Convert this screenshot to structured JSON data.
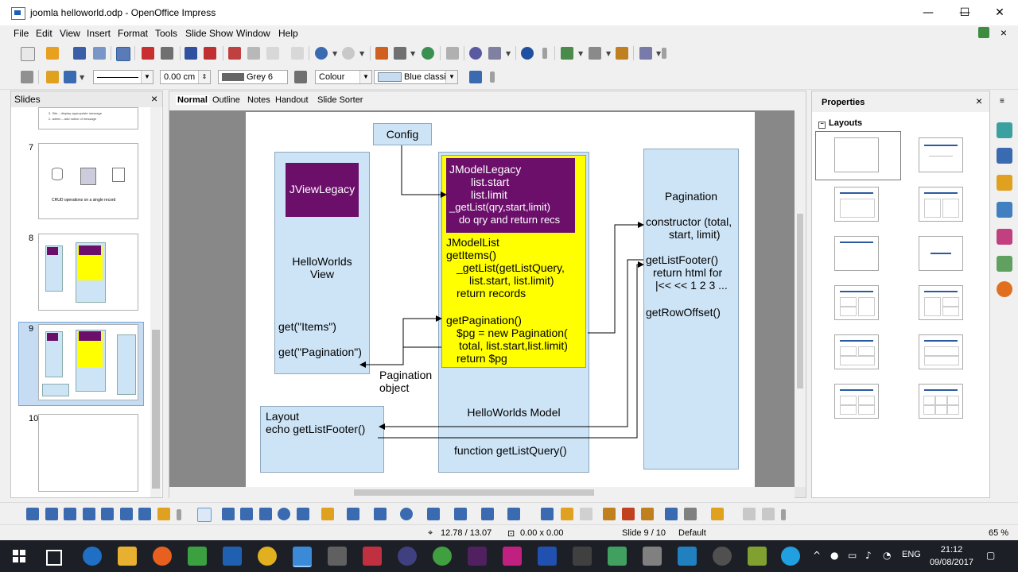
{
  "window": {
    "title": "joomla helloworld.odp - OpenOffice Impress",
    "minimize": "—",
    "maximize": "☐",
    "close": "✕"
  },
  "menu": [
    "File",
    "Edit",
    "View",
    "Insert",
    "Format",
    "Tools",
    "Slide Show",
    "Window",
    "Help"
  ],
  "toolbar2": {
    "line_width": "0.00 cm",
    "line_color": "Grey 6",
    "area_style": "Colour",
    "area_fill": "Blue classic"
  },
  "slides_panel": {
    "title": "Slides",
    "close": "×",
    "slide6_lines": [
      "3. Site – display appropriate message",
      "2. admin – add notice of message"
    ],
    "slide7_caption": "CRUD operations on a single record",
    "numbers": [
      "7",
      "8",
      "9",
      "10"
    ]
  },
  "view_tabs": [
    "Normal",
    "Outline",
    "Notes",
    "Handout",
    "Slide Sorter"
  ],
  "slide": {
    "config": "Config",
    "jviewlegacy": "JViewLegacy",
    "view_label": [
      "HelloWorlds",
      "View"
    ],
    "get_items": "get(\"Items\")",
    "get_pagination": "get(\"Pagination\")",
    "pagination_object": [
      "Pagination",
      "object"
    ],
    "layout": [
      "Layout",
      "echo getListFooter()"
    ],
    "jmodellegacy": [
      "JModelLegacy",
      "list.start",
      "list.limit",
      "_getList(qry,start,limit)",
      "do qry and return recs"
    ],
    "jmodellist": [
      "JModelList",
      "getItems()",
      "_getList(getListQuery,",
      "list.start, list.limit)",
      "return records"
    ],
    "getpagination": [
      "getPagination()",
      "$pg = new Pagination(",
      "total, list.start,list.limit)",
      "return $pg"
    ],
    "model_label": "HelloWorlds Model",
    "function_getlistquery": "function getListQuery()",
    "pagination": [
      "Pagination",
      "constructor (total,",
      "start, limit)",
      "getListFooter()",
      "return html for",
      "|<< << 1 2 3 ...",
      "getRowOffset()"
    ]
  },
  "properties": {
    "title": "Properties",
    "close": "×",
    "section": "Layouts"
  },
  "status": {
    "position": "12.78 / 13.07",
    "size": "0.00 x 0.00",
    "slide": "Slide 9 / 10",
    "master": "Default",
    "zoom": "65 %"
  },
  "taskbar": {
    "time": "21:12",
    "date": "09/08/2017",
    "lang": "ENG"
  }
}
